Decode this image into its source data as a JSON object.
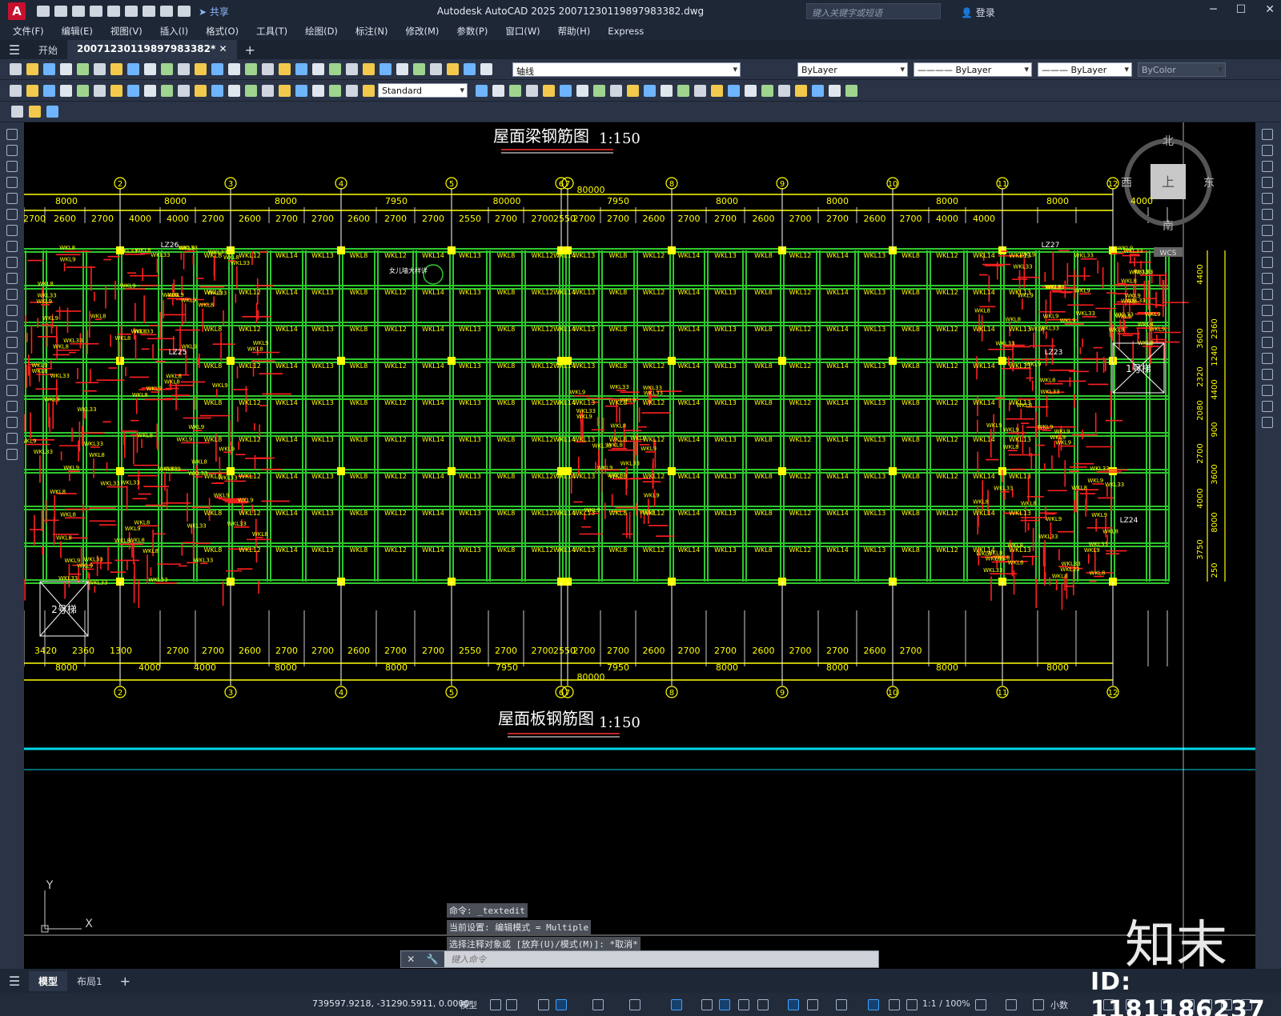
{
  "window": {
    "logo": "A",
    "share_label": "共享",
    "title": "Autodesk AutoCAD 2025    20071230119897983382.dwg",
    "search_placeholder": "键入关键字或短语",
    "login_label": "登录",
    "min": "─",
    "max": "☐",
    "close": "✕"
  },
  "menu": [
    "文件(F)",
    "编辑(E)",
    "视图(V)",
    "插入(I)",
    "格式(O)",
    "工具(T)",
    "绘图(D)",
    "标注(N)",
    "修改(M)",
    "参数(P)",
    "窗口(W)",
    "帮助(H)",
    "Express"
  ],
  "tabs": [
    {
      "label": "开始",
      "active": false
    },
    {
      "label": "20071230119897983382*",
      "active": true
    }
  ],
  "toolbar": {
    "layer_combo": "轴线",
    "color_combo": "ByLayer",
    "linetype_combo": "———— ByLayer",
    "lineweight_combo": "——— ByLayer",
    "plotstyle_combo": "ByColor",
    "textstyle_combo": "Standard"
  },
  "drawing": {
    "title_top": "屋面梁钢筋图",
    "title_bottom": "屋面板钢筋图",
    "scale": "1:150",
    "total_dim": "80000",
    "axes": [
      "2",
      "3",
      "4",
      "5",
      "6",
      "7",
      "8",
      "9",
      "10",
      "11",
      "12"
    ],
    "top_dims": [
      "8000",
      "8000",
      "8000",
      "7950",
      "80000",
      "7950",
      "8000",
      "8000",
      "8000",
      "8000",
      "4000"
    ],
    "sub_dims": [
      "2700",
      "2600",
      "2700",
      "4000",
      "4000",
      "2700",
      "2600",
      "2700",
      "2700",
      "2600",
      "2700",
      "2700",
      "2550",
      "2700",
      "2700",
      "2550",
      "2700",
      "2700",
      "2600",
      "2700",
      "2700",
      "2600",
      "2700",
      "2700",
      "2600",
      "2700",
      "4000",
      "4000"
    ],
    "bottom_sub_dims": [
      "3420",
      "2360",
      "1300",
      "2700",
      "2700",
      "2600",
      "2700",
      "2700",
      "2600",
      "2700",
      "2700",
      "2550",
      "2700",
      "2700",
      "2550",
      "2700",
      "2700",
      "2600",
      "2700",
      "2700",
      "2600",
      "2700",
      "2700",
      "2600",
      "2700"
    ],
    "bottom_dims": [
      "8000",
      "4000",
      "4000",
      "8000",
      "8000",
      "7950",
      "7950",
      "8000",
      "8000",
      "8000",
      "8000"
    ],
    "right_dims": [
      "4400",
      "2360",
      "3600",
      "1240",
      "2320",
      "4400",
      "2080",
      "900",
      "2700",
      "3600",
      "4000",
      "8000",
      "3750",
      "250"
    ],
    "labels": {
      "lz26": "LZ26",
      "lz27": "LZ27",
      "lz23": "LZ23",
      "lz24": "LZ24",
      "lz25": "LZ25",
      "stair1": "1号梯",
      "stair2": "2号梯",
      "note": "女儿墙大样详"
    },
    "compass": {
      "n": "北",
      "s": "南",
      "e": "东",
      "w": "西",
      "top": "上",
      "wcs": "WCS"
    },
    "ucs": {
      "x": "X",
      "y": "Y"
    }
  },
  "beams": [
    "WKL8",
    "WKL10",
    "WKL7",
    "WKL12",
    "WKL9",
    "WKL11",
    "WKL14",
    "WKL32",
    "WKL33",
    "WKL13",
    "WKL15",
    "WKL31"
  ],
  "command": {
    "history": [
      "命令: _textedit",
      "当前设置: 编辑模式 = Multiple",
      "选择注释对象或 [放弃(U)/模式(M)]: *取消*"
    ],
    "placeholder": "键入命令"
  },
  "layout_tabs": [
    {
      "label": "模型",
      "active": true
    },
    {
      "label": "布局1",
      "active": false
    }
  ],
  "status": {
    "coords": "739597.9218, -31290.5911, 0.0000",
    "model": "模型",
    "scale": "1:1 / 100%",
    "units": "小数"
  },
  "watermark": {
    "id": "ID: 1181186237",
    "logo": "知末"
  },
  "colors": {
    "canvas": "#000000",
    "grid": "#2ec82e",
    "dim": "#ffff00",
    "rebar": "#ff2020",
    "cyan": "#00d8e8",
    "ui": "#2a3446"
  }
}
